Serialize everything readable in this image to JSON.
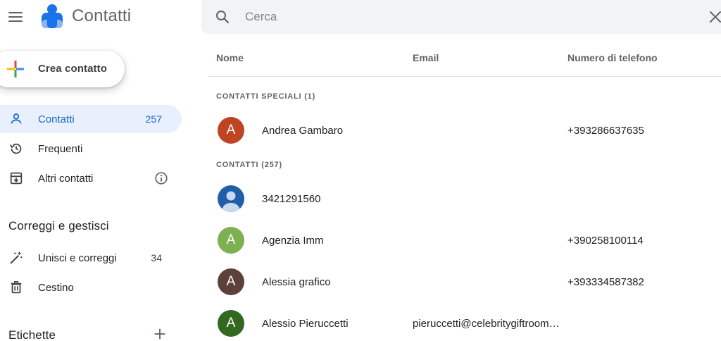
{
  "header": {
    "app_title": "Contatti",
    "search_placeholder": "Cerca",
    "icons": {
      "menu": "hamburger-menu-icon",
      "logo": "contacts-logo-icon",
      "search": "search-icon",
      "close": "close-icon"
    }
  },
  "sidebar": {
    "create_label": "Crea contatto",
    "nav": [
      {
        "label": "Contatti",
        "count": "257",
        "icon": "person-icon",
        "active": true
      },
      {
        "label": "Frequenti",
        "count": "",
        "icon": "history-icon",
        "active": false
      },
      {
        "label": "Altri contatti",
        "count": "",
        "icon": "archive-icon",
        "active": false
      }
    ],
    "manage_title": "Correggi e gestisci",
    "manage": [
      {
        "label": "Unisci e correggi",
        "count": "34",
        "icon": "magic-wand-icon"
      },
      {
        "label": "Cestino",
        "count": "",
        "icon": "trash-icon"
      }
    ],
    "labels_title": "Etichette"
  },
  "table": {
    "columns": {
      "name": "Nome",
      "email": "Email",
      "phone": "Numero di telefono"
    },
    "starred_header": "CONTATTI SPECIALI (1)",
    "all_header": "CONTATTI (257)",
    "starred": [
      {
        "initial": "A",
        "name": "Andrea Gambaro",
        "email": "",
        "phone": "+393286637635",
        "color": "#bf4424"
      }
    ],
    "contacts": [
      {
        "initial": "",
        "name": "3421291560",
        "email": "",
        "phone": "",
        "color": "#1f5ea8"
      },
      {
        "initial": "A",
        "name": "Agenzia Imm",
        "email": "",
        "phone": "+390258100114",
        "color": "#7cb050"
      },
      {
        "initial": "A",
        "name": "Alessia grafico",
        "email": "",
        "phone": "+393334587382",
        "color": "#5d4037"
      },
      {
        "initial": "A",
        "name": "Alessio Pieruccetti",
        "email": "pieruccetti@celebritygiftroom…",
        "phone": "",
        "color": "#33691e"
      }
    ]
  },
  "colors": {
    "accent": "#1967d2",
    "active_bg": "#e8f0fe",
    "search_bg": "#f1f3f4"
  }
}
